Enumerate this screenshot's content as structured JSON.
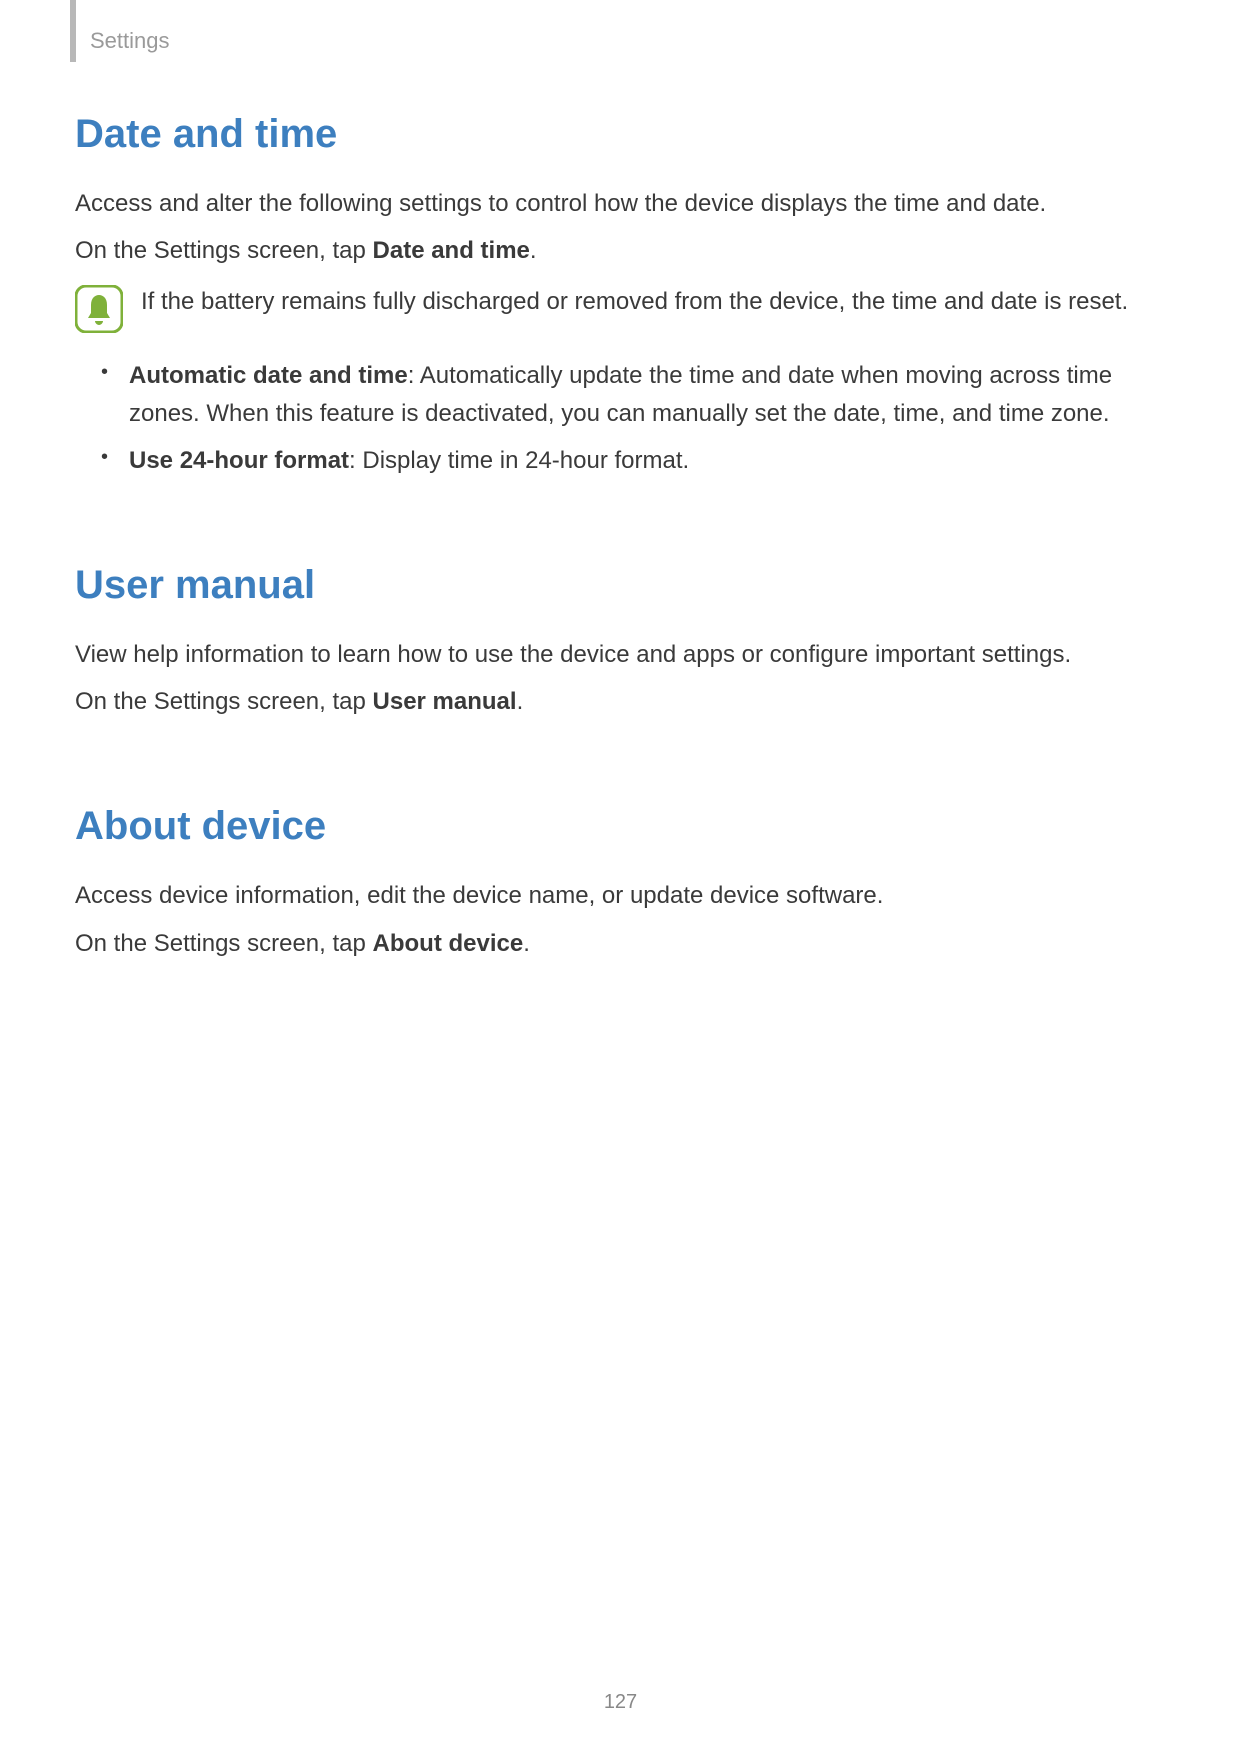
{
  "header": {
    "breadcrumb": "Settings"
  },
  "sections": {
    "dateTime": {
      "heading": "Date and time",
      "intro": "Access and alter the following settings to control how the device displays the time and date.",
      "nav_prefix": "On the Settings screen, tap ",
      "nav_bold": "Date and time",
      "nav_suffix": ".",
      "note": "If the battery remains fully discharged or removed from the device, the time and date is reset.",
      "items": [
        {
          "label": "Automatic date and time",
          "desc": ": Automatically update the time and date when moving across time zones. When this feature is deactivated, you can manually set the date, time, and time zone."
        },
        {
          "label": "Use 24-hour format",
          "desc": ": Display time in 24-hour format."
        }
      ]
    },
    "userManual": {
      "heading": "User manual",
      "intro": "View help information to learn how to use the device and apps or configure important settings.",
      "nav_prefix": "On the Settings screen, tap ",
      "nav_bold": "User manual",
      "nav_suffix": "."
    },
    "aboutDevice": {
      "heading": "About device",
      "intro": "Access device information, edit the device name, or update device software.",
      "nav_prefix": "On the Settings screen, tap ",
      "nav_bold": "About device",
      "nav_suffix": "."
    }
  },
  "pageNumber": "127"
}
